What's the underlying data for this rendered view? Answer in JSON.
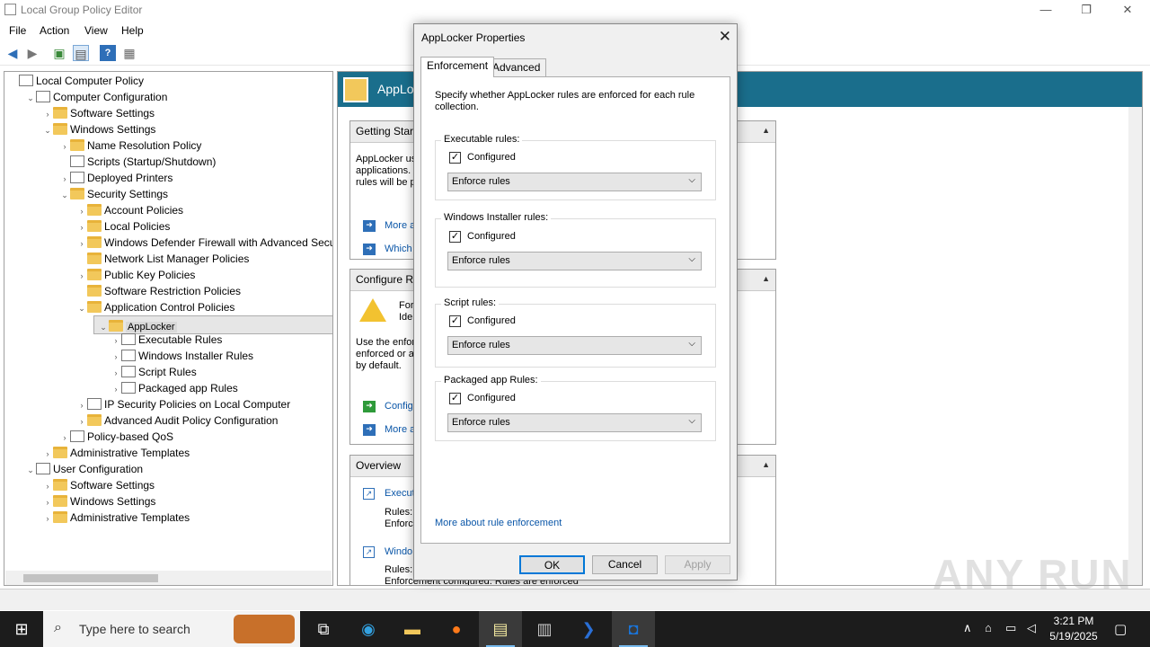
{
  "window": {
    "title": "Local Group Policy Editor",
    "minimize": "—",
    "maximize": "❐",
    "close": "✕"
  },
  "menu": [
    "File",
    "Action",
    "View",
    "Help"
  ],
  "tree": [
    {
      "label": "Local Computer Policy",
      "depth": 0,
      "toggle": "",
      "icon": "doc"
    },
    {
      "label": "Computer Configuration",
      "depth": 1,
      "toggle": "v",
      "icon": "computer"
    },
    {
      "label": "Software Settings",
      "depth": 2,
      "toggle": ">",
      "icon": "folder"
    },
    {
      "label": "Windows Settings",
      "depth": 2,
      "toggle": "v",
      "icon": "folder"
    },
    {
      "label": "Name Resolution Policy",
      "depth": 3,
      "toggle": ">",
      "icon": "folder"
    },
    {
      "label": "Scripts (Startup/Shutdown)",
      "depth": 3,
      "toggle": "",
      "icon": "doc"
    },
    {
      "label": "Deployed Printers",
      "depth": 3,
      "toggle": ">",
      "icon": "printer"
    },
    {
      "label": "Security Settings",
      "depth": 3,
      "toggle": "v",
      "icon": "security"
    },
    {
      "label": "Account Policies",
      "depth": 4,
      "toggle": ">",
      "icon": "folder-lock"
    },
    {
      "label": "Local Policies",
      "depth": 4,
      "toggle": ">",
      "icon": "folder-lock"
    },
    {
      "label": "Windows Defender Firewall with Advanced Securit",
      "depth": 4,
      "toggle": ">",
      "icon": "folder"
    },
    {
      "label": "Network List Manager Policies",
      "depth": 4,
      "toggle": "",
      "icon": "folder"
    },
    {
      "label": "Public Key Policies",
      "depth": 4,
      "toggle": ">",
      "icon": "folder"
    },
    {
      "label": "Software Restriction Policies",
      "depth": 4,
      "toggle": "",
      "icon": "folder"
    },
    {
      "label": "Application Control Policies",
      "depth": 4,
      "toggle": "v",
      "icon": "folder"
    },
    {
      "label": "AppLocker",
      "depth": 5,
      "toggle": "v",
      "icon": "applocker",
      "selected": true
    },
    {
      "label": "Executable Rules",
      "depth": 6,
      "toggle": ">",
      "icon": "window"
    },
    {
      "label": "Windows Installer Rules",
      "depth": 6,
      "toggle": ">",
      "icon": "installer"
    },
    {
      "label": "Script Rules",
      "depth": 6,
      "toggle": ">",
      "icon": "doc"
    },
    {
      "label": "Packaged app Rules",
      "depth": 6,
      "toggle": ">",
      "icon": "package"
    },
    {
      "label": "IP Security Policies on Local Computer",
      "depth": 4,
      "toggle": ">",
      "icon": "ipsec"
    },
    {
      "label": "Advanced Audit Policy Configuration",
      "depth": 4,
      "toggle": ">",
      "icon": "folder"
    },
    {
      "label": "Policy-based QoS",
      "depth": 3,
      "toggle": ">",
      "icon": "chart"
    },
    {
      "label": "Administrative Templates",
      "depth": 2,
      "toggle": ">",
      "icon": "folder"
    },
    {
      "label": "User Configuration",
      "depth": 1,
      "toggle": "v",
      "icon": "users"
    },
    {
      "label": "Software Settings",
      "depth": 2,
      "toggle": ">",
      "icon": "folder"
    },
    {
      "label": "Windows Settings",
      "depth": 2,
      "toggle": ">",
      "icon": "folder"
    },
    {
      "label": "Administrative Templates",
      "depth": 2,
      "toggle": ">",
      "icon": "folder"
    }
  ],
  "right": {
    "banner_title": "AppLoc",
    "getting_started": {
      "title": "Getting Start",
      "text1": "AppLocker us",
      "text2": "applications. I",
      "text3": "rules will be pe",
      "link1": "More a",
      "link2": "Which"
    },
    "configure": {
      "title": "Configure Ru",
      "warn1": "For",
      "warn2": "Iden",
      "text1": "Use the enfor",
      "text2": "enforced or a",
      "text3": "by default.",
      "link1": "Configu",
      "link2": "More a"
    },
    "overview": {
      "title": "Overview",
      "item1": "Execut",
      "item1_rules": "Rules:",
      "item1_enf": "Enforc",
      "item2": "Windo",
      "item2_rules": "Rules:",
      "item2_enf": "Enforcement configured: Rules are enforced"
    }
  },
  "dialog": {
    "title": "AppLocker Properties",
    "tabs": [
      "Enforcement",
      "Advanced"
    ],
    "intro": "Specify whether AppLocker rules are enforced for each rule collection.",
    "groups": [
      {
        "label": "Executable rules:",
        "checkbox": "Configured",
        "checked": true,
        "select": "Enforce rules"
      },
      {
        "label": "Windows Installer rules:",
        "checkbox": "Configured",
        "checked": true,
        "select": "Enforce rules"
      },
      {
        "label": "Script rules:",
        "checkbox": "Configured",
        "checked": true,
        "select": "Enforce rules"
      },
      {
        "label": "Packaged app Rules:",
        "checkbox": "Configured",
        "checked": true,
        "select": "Enforce rules"
      }
    ],
    "more_link": "More about rule enforcement",
    "ok": "OK",
    "cancel": "Cancel",
    "apply": "Apply"
  },
  "watermark": "ANY RUN",
  "taskbar": {
    "search_placeholder": "Type here to search",
    "time": "3:21 PM",
    "date": "5/19/2025"
  },
  "colors": {
    "banner": "#1a6e8c",
    "link": "#0a56a8",
    "taskbar": "#1c1c1c"
  }
}
